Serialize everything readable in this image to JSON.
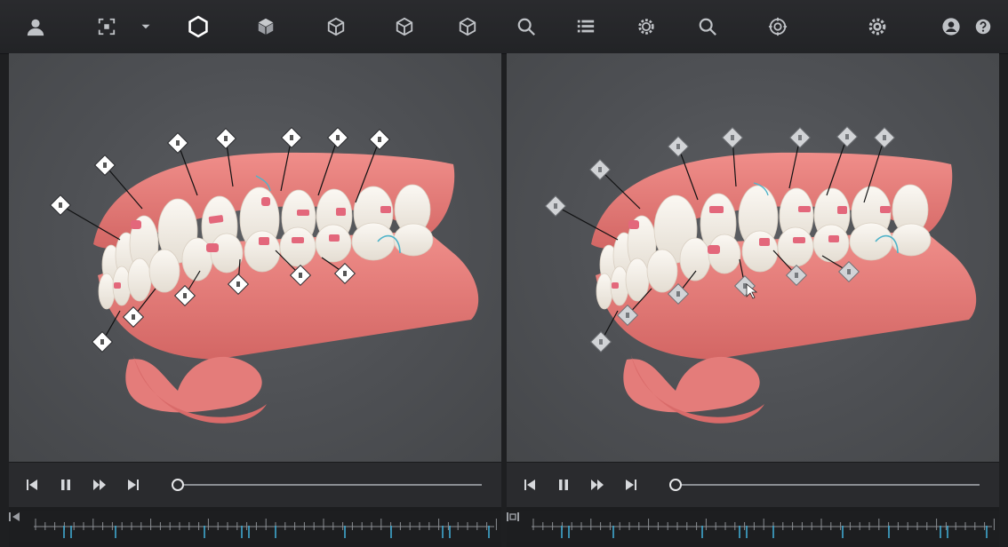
{
  "toolbar": {
    "icons": [
      "user-icon",
      "capture-icon",
      "chevron-down-icon",
      "hexagon-icon",
      "cube-front-icon",
      "cube-side-icon",
      "cube-top-icon",
      "cube-iso-icon",
      "search-icon",
      "list-icon",
      "gear-badge-icon",
      "search-2-icon",
      "target-icon",
      "settings-icon",
      "account-icon",
      "help-icon"
    ],
    "active": "hexagon-icon"
  },
  "panes": [
    {
      "id": "left",
      "marker_style": "white",
      "slider_progress": 0.0
    },
    {
      "id": "right",
      "marker_style": "gray",
      "slider_progress": 0.0
    }
  ],
  "colors": {
    "accent": "#3fa8cf",
    "gum": "#e47c7a",
    "tooth": "#f1ece4",
    "attachment": "#e3677b",
    "wire": "#4fb3c9"
  }
}
